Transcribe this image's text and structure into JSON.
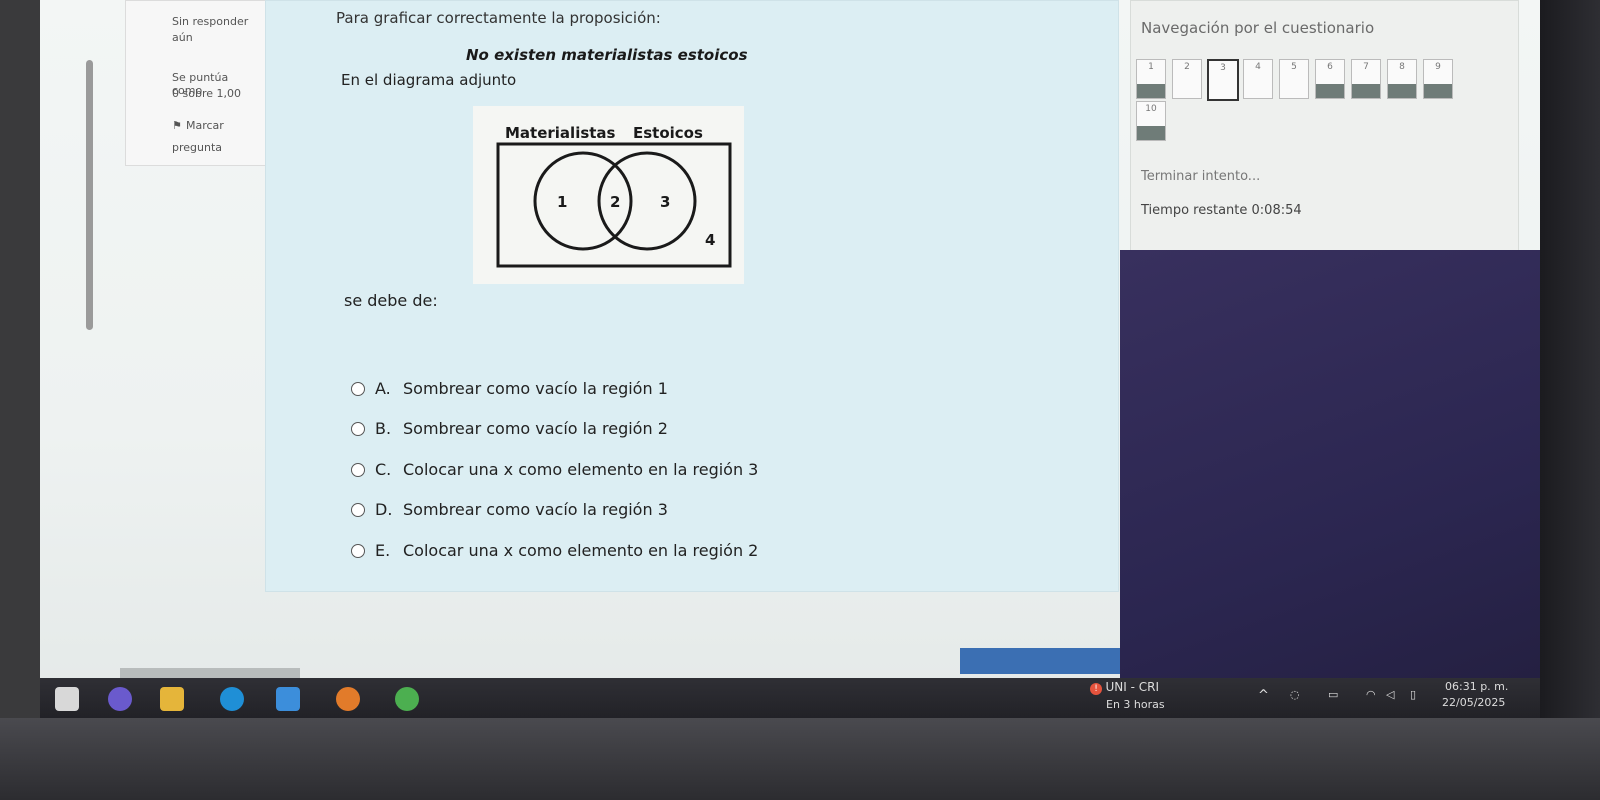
{
  "info": {
    "status_line1": "Sin responder",
    "status_line2": "aún",
    "score_line1": "Se puntúa como",
    "score_line2": "0 sobre 1,00",
    "flag_line1": "Marcar",
    "flag_line2": "pregunta"
  },
  "question": {
    "intro": "Para graficar correctamente la proposición:",
    "proposition": "No existen materialistas estoicos",
    "diagram_text": "En el diagrama adjunto",
    "prompt": "se debe de:",
    "diagram": {
      "label_left": "Materialistas",
      "label_right": "Estoicos",
      "regions": [
        "1",
        "2",
        "3",
        "4"
      ]
    },
    "options": [
      {
        "letter": "A.",
        "text": "Sombrear como vacío la región 1"
      },
      {
        "letter": "B.",
        "text": "Sombrear como vacío la región 2"
      },
      {
        "letter": "C.",
        "text": "Colocar una x como elemento en la región 3"
      },
      {
        "letter": "D.",
        "text": "Sombrear como vacío la región 3"
      },
      {
        "letter": "E.",
        "text": "Colocar una x como elemento en la región 2"
      }
    ]
  },
  "nav": {
    "title": "Navegación por el cuestionario",
    "buttons": [
      "1",
      "2",
      "3",
      "4",
      "5",
      "6",
      "7",
      "8",
      "9",
      "10"
    ],
    "finish": "Terminar intento...",
    "time_label": "Tiempo restante",
    "time_value": "0:08:54"
  },
  "taskbar": {
    "weather_title": "UNI - CRI",
    "weather_sub": "En 3 horas",
    "time": "06:31 p. m.",
    "date": "22/05/2025"
  }
}
